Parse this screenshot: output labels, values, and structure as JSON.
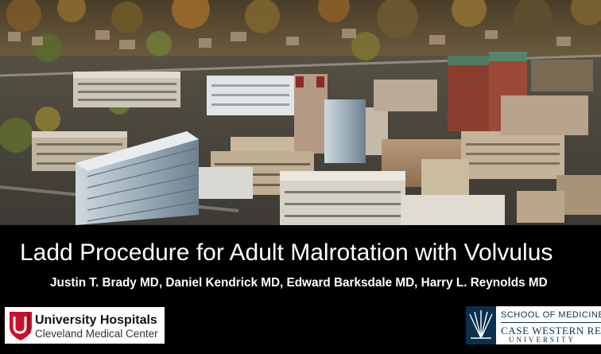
{
  "slide": {
    "title": "Ladd Procedure for Adult Malrotation with Volvulus",
    "authors": "Justin T. Brady MD, Daniel Kendrick MD, Edward Barksdale MD, Harry L. Reynolds MD"
  },
  "logos": {
    "uh": {
      "initials": "UH",
      "name": "University Hospitals",
      "subtitle": "Cleveland Medical Center"
    },
    "cwru": {
      "school": "SCHOOL OF MEDICINE",
      "name": "CASE WESTERN RESERVE",
      "university": "UNIVERSITY"
    }
  },
  "colors": {
    "background": "#000000",
    "title_text": "#ffffff",
    "uh_red": "#c8102e",
    "cwru_navy": "#0a304e"
  },
  "icons": {
    "uh_mark": "uh-shield-icon",
    "cwru_seal": "cwru-seal-icon"
  }
}
